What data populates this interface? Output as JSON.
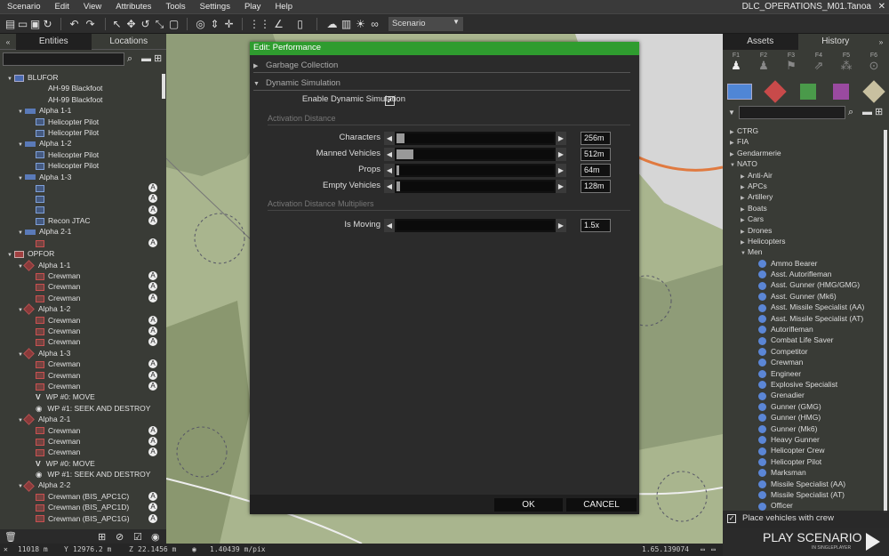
{
  "menubar": {
    "items": [
      "Scenario",
      "Edit",
      "View",
      "Attributes",
      "Tools",
      "Settings",
      "Play",
      "Help"
    ],
    "title": "DLC_OPERATIONS_M01.Tanoa"
  },
  "toolbar": {
    "scenario_select": "Scenario"
  },
  "left_panel": {
    "tabs": [
      "Entities",
      "Locations"
    ],
    "tree": [
      {
        "label": "BLUFOR",
        "level": 0,
        "kind": "flag"
      },
      {
        "label": "AH-99 Blackfoot",
        "level": 2,
        "kind": "none"
      },
      {
        "label": "AH-99 Blackfoot",
        "level": 2,
        "kind": "none"
      },
      {
        "label": "Alpha 1-1",
        "level": 1,
        "kind": "grp"
      },
      {
        "label": "Helicopter Pilot",
        "level": 2,
        "kind": "blue"
      },
      {
        "label": "Helicopter Pilot",
        "level": 2,
        "kind": "blue"
      },
      {
        "label": "Alpha 1-2",
        "level": 1,
        "kind": "grp"
      },
      {
        "label": "Helicopter Pilot",
        "level": 2,
        "kind": "blue"
      },
      {
        "label": "Helicopter Pilot",
        "level": 2,
        "kind": "blue"
      },
      {
        "label": "Alpha 1-3",
        "level": 1,
        "kind": "grp"
      },
      {
        "label": "",
        "level": 2,
        "kind": "ghost",
        "ai": true
      },
      {
        "label": "",
        "level": 2,
        "kind": "ghost",
        "ai": true
      },
      {
        "label": "",
        "level": 2,
        "kind": "ghost",
        "ai": true
      },
      {
        "label": "Recon JTAC",
        "level": 2,
        "kind": "blue",
        "ai": true
      },
      {
        "label": "Alpha 2-1",
        "level": 1,
        "kind": "grp"
      },
      {
        "label": "",
        "level": 2,
        "kind": "ghostr",
        "ai": true
      },
      {
        "label": "OPFOR",
        "level": 0,
        "kind": "flagr"
      },
      {
        "label": "Alpha 1-1",
        "level": 1,
        "kind": "grpr"
      },
      {
        "label": "Crewman",
        "level": 2,
        "kind": "red",
        "ai": true
      },
      {
        "label": "Crewman",
        "level": 2,
        "kind": "red",
        "ai": true
      },
      {
        "label": "Crewman",
        "level": 2,
        "kind": "red",
        "ai": true
      },
      {
        "label": "Alpha 1-2",
        "level": 1,
        "kind": "grpr"
      },
      {
        "label": "Crewman",
        "level": 2,
        "kind": "red",
        "ai": true
      },
      {
        "label": "Crewman",
        "level": 2,
        "kind": "red",
        "ai": true
      },
      {
        "label": "Crewman",
        "level": 2,
        "kind": "red",
        "ai": true
      },
      {
        "label": "Alpha 1-3",
        "level": 1,
        "kind": "grpr"
      },
      {
        "label": "Crewman",
        "level": 2,
        "kind": "red",
        "ai": true
      },
      {
        "label": "Crewman",
        "level": 2,
        "kind": "red",
        "ai": true
      },
      {
        "label": "Crewman",
        "level": 2,
        "kind": "red",
        "ai": true
      },
      {
        "label": "WP #0: MOVE",
        "level": 2,
        "kind": "wp"
      },
      {
        "label": "WP #1: SEEK AND DESTROY",
        "level": 2,
        "kind": "eye"
      },
      {
        "label": "Alpha 2-1",
        "level": 1,
        "kind": "grpr"
      },
      {
        "label": "Crewman",
        "level": 2,
        "kind": "red",
        "ai": true
      },
      {
        "label": "Crewman",
        "level": 2,
        "kind": "red",
        "ai": true
      },
      {
        "label": "Crewman",
        "level": 2,
        "kind": "red",
        "ai": true
      },
      {
        "label": "WP #0: MOVE",
        "level": 2,
        "kind": "wp"
      },
      {
        "label": "WP #1: SEEK AND DESTROY",
        "level": 2,
        "kind": "eye"
      },
      {
        "label": "Alpha 2-2",
        "level": 1,
        "kind": "grpr"
      },
      {
        "label": "Crewman (BIS_APC1C)",
        "level": 2,
        "kind": "red",
        "ai": true
      },
      {
        "label": "Crewman (BIS_APC1D)",
        "level": 2,
        "kind": "red",
        "ai": true
      },
      {
        "label": "Crewman (BIS_APC1G)",
        "level": 2,
        "kind": "red",
        "ai": true
      }
    ]
  },
  "right_panel": {
    "tabs": [
      "Assets",
      "History"
    ],
    "fkeys": [
      "F1",
      "F2",
      "F3",
      "F4",
      "F5",
      "F6"
    ],
    "swatch_colors": [
      "#4f86d6",
      "#c84a4a",
      "#4a9a4a",
      "#9a4aa0",
      "#c8c0a0"
    ],
    "tree": [
      {
        "label": "CTRG",
        "level": 0,
        "open": false
      },
      {
        "label": "FIA",
        "level": 0,
        "open": false
      },
      {
        "label": "Gendarmerie",
        "level": 0,
        "open": false
      },
      {
        "label": "NATO",
        "level": 0,
        "open": true
      },
      {
        "label": "Anti-Air",
        "level": 1,
        "open": false
      },
      {
        "label": "APCs",
        "level": 1,
        "open": false
      },
      {
        "label": "Artillery",
        "level": 1,
        "open": false
      },
      {
        "label": "Boats",
        "level": 1,
        "open": false
      },
      {
        "label": "Cars",
        "level": 1,
        "open": false
      },
      {
        "label": "Drones",
        "level": 1,
        "open": false
      },
      {
        "label": "Helicopters",
        "level": 1,
        "open": false
      },
      {
        "label": "Men",
        "level": 1,
        "open": true
      },
      {
        "label": "Ammo Bearer",
        "level": 2
      },
      {
        "label": "Asst. Autorifleman",
        "level": 2
      },
      {
        "label": "Asst. Gunner (HMG/GMG)",
        "level": 2
      },
      {
        "label": "Asst. Gunner (Mk6)",
        "level": 2
      },
      {
        "label": "Asst. Missile Specialist (AA)",
        "level": 2
      },
      {
        "label": "Asst. Missile Specialist (AT)",
        "level": 2
      },
      {
        "label": "Autorifleman",
        "level": 2
      },
      {
        "label": "Combat Life Saver",
        "level": 2
      },
      {
        "label": "Competitor",
        "level": 2
      },
      {
        "label": "Crewman",
        "level": 2
      },
      {
        "label": "Engineer",
        "level": 2
      },
      {
        "label": "Explosive Specialist",
        "level": 2
      },
      {
        "label": "Grenadier",
        "level": 2
      },
      {
        "label": "Gunner (GMG)",
        "level": 2
      },
      {
        "label": "Gunner (HMG)",
        "level": 2
      },
      {
        "label": "Gunner (Mk6)",
        "level": 2
      },
      {
        "label": "Heavy Gunner",
        "level": 2
      },
      {
        "label": "Helicopter Crew",
        "level": 2
      },
      {
        "label": "Helicopter Pilot",
        "level": 2
      },
      {
        "label": "Marksman",
        "level": 2
      },
      {
        "label": "Missile Specialist (AA)",
        "level": 2
      },
      {
        "label": "Missile Specialist (AT)",
        "level": 2
      },
      {
        "label": "Officer",
        "level": 2
      }
    ],
    "place_with_crew": "Place vehicles with crew",
    "play_title": "PLAY SCENARIO",
    "play_sub": "IN SINGLEPLAYER"
  },
  "status": {
    "x": "11018 m",
    "y": "12976.2 m",
    "z": "22.1456 m",
    "speed": "1.40439 m/pix",
    "scale": "1.65.139074"
  },
  "dialog": {
    "title": "Edit: Performance",
    "garbage": "Garbage Collection",
    "dynsim": "Dynamic Simulation",
    "enable_label": "Enable Dynamic Simulation",
    "enable_checked": true,
    "act_dist": "Activation Distance",
    "sliders": [
      {
        "label": "Characters",
        "value": "256m",
        "fraction": 0.05
      },
      {
        "label": "Manned Vehicles",
        "value": "512m",
        "fraction": 0.11
      },
      {
        "label": "Props",
        "value": "64m",
        "fraction": 0.0
      },
      {
        "label": "Empty Vehicles",
        "value": "128m",
        "fraction": 0.02
      }
    ],
    "mult": "Activation Distance Multipliers",
    "moving": {
      "label": "Is Moving",
      "value": "1.5x",
      "fraction": 0.0
    },
    "ok": "OK",
    "cancel": "CANCEL"
  }
}
